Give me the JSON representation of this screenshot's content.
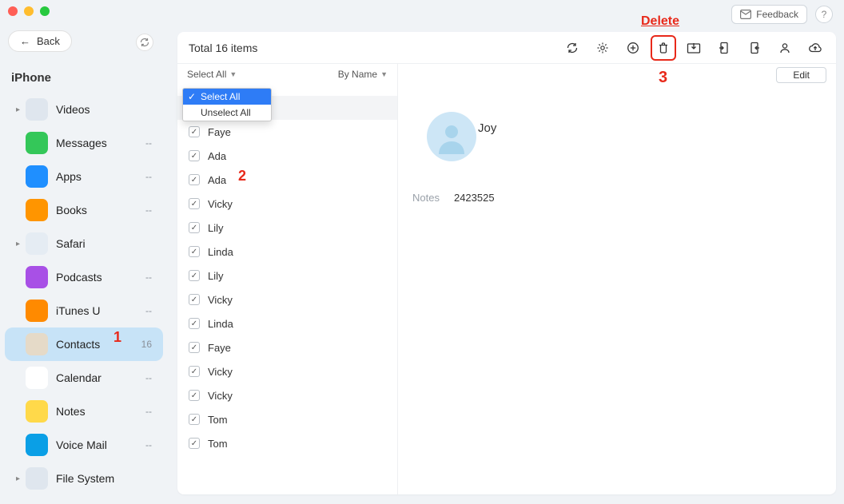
{
  "window": {
    "back": "Back",
    "feedback": "Feedback",
    "help": "?"
  },
  "device_title": "iPhone",
  "sidebar": {
    "items": [
      {
        "label": "Videos",
        "count": "",
        "color": "#dfe6ee",
        "expandable": true
      },
      {
        "label": "Messages",
        "count": "--",
        "color": "#34C759"
      },
      {
        "label": "Apps",
        "count": "--",
        "color": "#1F8FFF"
      },
      {
        "label": "Books",
        "count": "--",
        "color": "#FF9500"
      },
      {
        "label": "Safari",
        "count": "",
        "color": "#e5ecf3",
        "expandable": true
      },
      {
        "label": "Podcasts",
        "count": "--",
        "color": "#A850E6"
      },
      {
        "label": "iTunes U",
        "count": "--",
        "color": "#FF8A00"
      },
      {
        "label": "Contacts",
        "count": "16",
        "color": "#E5DAC8",
        "active": true
      },
      {
        "label": "Calendar",
        "count": "--",
        "color": "#ffffff"
      },
      {
        "label": "Notes",
        "count": "--",
        "color": "#FFD94A"
      },
      {
        "label": "Voice Mail",
        "count": "--",
        "color": "#0A9FE6"
      },
      {
        "label": "File System",
        "count": "",
        "color": "#dfe6ee",
        "expandable": true
      }
    ]
  },
  "toolbar": {
    "total_label": "Total 16 items",
    "select_label": "Select All",
    "sort_label": "By Name",
    "dropdown": {
      "select_all": "Select All",
      "unselect_all": "Unselect All"
    },
    "edit": "Edit"
  },
  "annotations": {
    "delete_label": "Delete",
    "step1": "1",
    "step2": "2",
    "step3": "3"
  },
  "contacts": [
    {
      "name": "Joy",
      "selected": true
    },
    {
      "name": "Faye"
    },
    {
      "name": "Ada"
    },
    {
      "name": "Ada"
    },
    {
      "name": "Vicky"
    },
    {
      "name": "Lily"
    },
    {
      "name": "Linda"
    },
    {
      "name": "Lily"
    },
    {
      "name": "Vicky"
    },
    {
      "name": "Linda"
    },
    {
      "name": "Faye"
    },
    {
      "name": "Vicky"
    },
    {
      "name": "Vicky"
    },
    {
      "name": "Tom"
    },
    {
      "name": "Tom"
    }
  ],
  "detail": {
    "name": "Joy",
    "notes_key": "Notes",
    "notes_val": "2423525"
  }
}
